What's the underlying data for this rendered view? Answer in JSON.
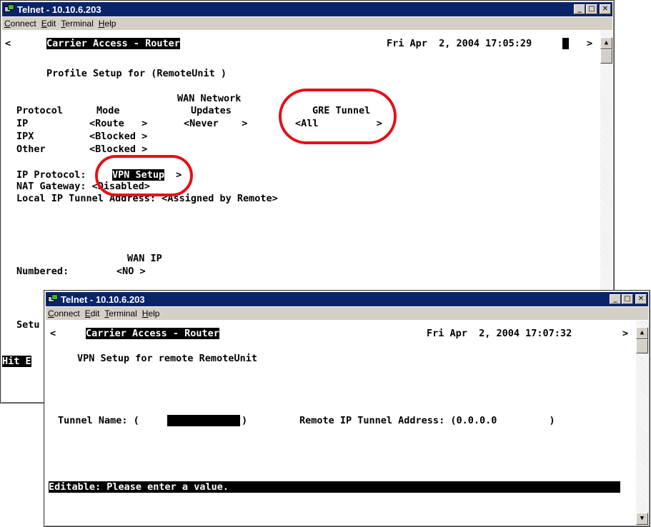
{
  "window1": {
    "title": "Telnet - 10.10.6.203",
    "menu": [
      "Connect",
      "Edit",
      "Terminal",
      "Help"
    ],
    "lines": {
      "scroll_left": "<",
      "header": "Carrier Access - Router",
      "datetime": "Fri Apr  2, 2004 17:05:29",
      "scroll_right": ">",
      "profile": "Profile Setup for (RemoteUnit )",
      "wan_network": "WAN Network",
      "col_protocol": "Protocol",
      "col_mode": "Mode",
      "col_updates": "Updates",
      "col_gre": "GRE Tunnel",
      "ip_name": "IP",
      "ip_mode": "<Route   >",
      "ip_updates": "<Never    >",
      "ip_gre": "<All          >",
      "ipx_name": "IPX",
      "ipx_mode": "<Blocked >",
      "other_name": "Other",
      "other_mode": "<Blocked >",
      "ip_protocol_label": "IP Protocol:",
      "vpn_setup": "VPN Setup",
      "vpn_suffix": " >",
      "nat_gateway": "NAT Gateway: <Disabled>",
      "local_ip": "Local IP Tunnel Address: <Assigned by Remote>",
      "wan_ip": "WAN IP",
      "numbered_label": "Numbered:",
      "numbered_value": "<NO >",
      "setu": "Setu",
      "hit_e": "Hit E"
    }
  },
  "window2": {
    "title": "Telnet - 10.10.6.203",
    "menu": [
      "Connect",
      "Edit",
      "Terminal",
      "Help"
    ],
    "lines": {
      "scroll_left": "<",
      "header": "Carrier Access - Router",
      "datetime": "Fri Apr  2, 2004 17:07:32",
      "scroll_right": ">",
      "vpn_title": "VPN Setup for remote RemoteUnit",
      "tunnel_label": "Tunnel Name: (",
      "tunnel_close": ")",
      "remote_ip": "Remote IP Tunnel Address: (0.0.0.0         )",
      "status": "Editable: Please enter a value."
    }
  },
  "colors": {
    "titlebar": "#0a246a",
    "highlight_circle": "#e3101a",
    "chrome": "#d4d0c8"
  }
}
